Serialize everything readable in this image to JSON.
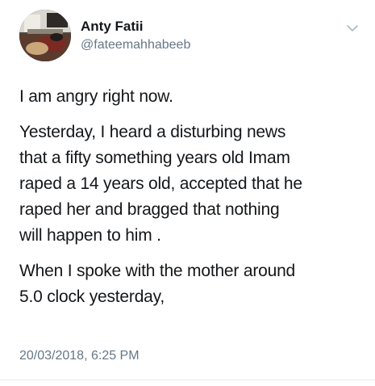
{
  "tweet": {
    "author": {
      "display_name": "Anty Fatii",
      "handle": "@fateemahhabeeb",
      "avatar_icon": "profile-photo"
    },
    "menu_icon": "chevron-down-icon",
    "paragraphs": [
      "I am angry right now.",
      "Yesterday, I heard a disturbing news\nthat a fifty something years old Imam\nraped a 14 years old, accepted that he\nraped her and bragged that nothing\nwill happen to him .",
      "When I spoke with the mother around\n5.0 clock yesterday,"
    ],
    "timestamp": "20/03/2018, 6:25 PM"
  },
  "colors": {
    "text_primary": "#14171a",
    "text_secondary": "#657786",
    "background": "#ffffff"
  }
}
